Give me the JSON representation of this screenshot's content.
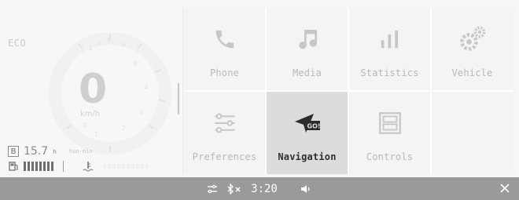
{
  "cluster": {
    "drive_mode": "ECO",
    "gear": "0",
    "speed_unit": "km/h",
    "trip_label": "B",
    "trip_value": "15.7",
    "trip_unit": "h",
    "small_text": "hun·min"
  },
  "menu": {
    "tiles": [
      {
        "label": "Phone",
        "icon": "phone-icon"
      },
      {
        "label": "Media",
        "icon": "music-note-icon"
      },
      {
        "label": "Statistics",
        "icon": "bar-chart-icon"
      },
      {
        "label": "Vehicle",
        "icon": "gears-icon"
      },
      {
        "label": "Preferences",
        "icon": "sliders-icon"
      },
      {
        "label": "Navigation",
        "icon": "navigation-go-icon",
        "active": true
      },
      {
        "label": "Controls",
        "icon": "controls-icon"
      }
    ]
  },
  "status_bar": {
    "time": "3:20"
  },
  "colors": {
    "active_tile": "#dcdcdc",
    "status_bar": "#9a9a9a",
    "active_text": "#2f2f2f"
  }
}
